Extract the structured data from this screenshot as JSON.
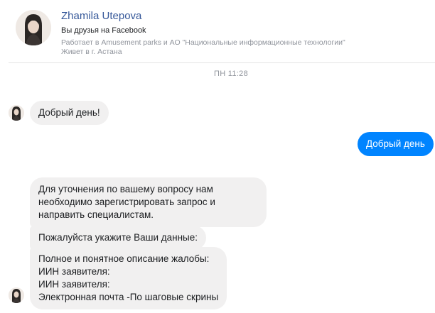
{
  "header": {
    "name": "Zhamila Utepova",
    "friends": "Вы друзья на Facebook",
    "work": "Работает в Amusement parks и АО \"Национальные информационные технологии\"",
    "city": "Живет в г. Астана"
  },
  "timestamp": "ПН 11:28",
  "messages": [
    {
      "from": "contact",
      "text": "Добрый день!"
    },
    {
      "from": "me",
      "text": "Добрый день"
    },
    {
      "from": "contact",
      "lines": [
        "Для уточнения по вашему вопросу нам",
        "необходимо зарегистрировать запрос и",
        "направить специалистам."
      ]
    },
    {
      "from": "contact",
      "text": "Пожалуйста укажите Ваши данные:"
    },
    {
      "from": "contact",
      "lines": [
        "Полное и понятное описание жалобы:",
        "ИИН заявителя:",
        "ИИН  заявителя:",
        "Электронная почта -По шаговые скрины"
      ]
    }
  ],
  "colors": {
    "outgoing_bubble": "#0084ff",
    "incoming_bubble": "#f1f0f0",
    "name_link": "#365899",
    "muted_text": "#90949c"
  },
  "icons": {
    "profile": "user-photo-icon",
    "avatar": "contact-avatar-icon"
  }
}
